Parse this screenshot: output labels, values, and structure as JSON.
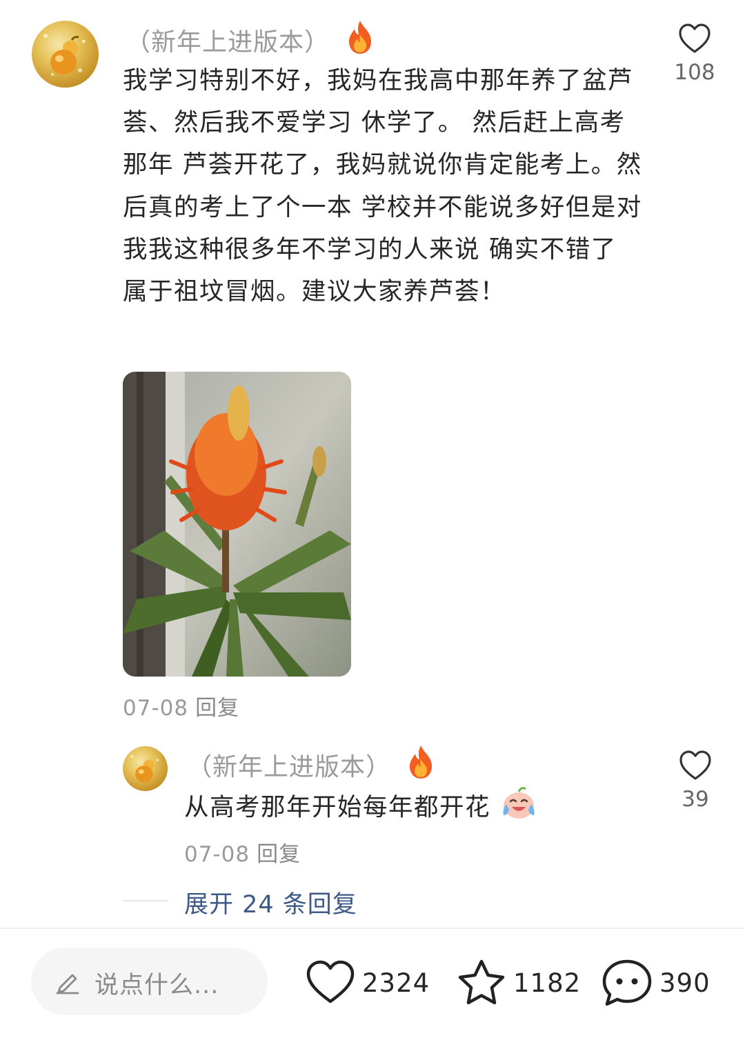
{
  "comment": {
    "username": "（新年上进版本）",
    "text": "我学习特别不好，我妈在我高中那年养了盆芦荟、然后我不爱学习 休学了。 然后赶上高考那年 芦荟开花了，我妈就说你肯定能考上。然后真的考上了个一本 学校并不能说多好但是对我我这种很多年不学习的人来说 确实不错了 属于祖坟冒烟。建议大家养芦荟！",
    "likes": "108",
    "date": "07-08",
    "reply_label": "回复"
  },
  "reply": {
    "username": "（新年上进版本）",
    "text": "从高考那年开始每年都开花",
    "likes": "39",
    "date": "07-08",
    "reply_label": "回复"
  },
  "expand_label": "展开 24 条回复",
  "bottom_bar": {
    "input_placeholder": "说点什么...",
    "likes": "2324",
    "favorites": "1182",
    "comments": "390"
  },
  "icons": {
    "badge": "fire-icon",
    "like": "heart-icon",
    "favorite": "star-icon",
    "comment": "chat-bubble-icon",
    "input": "pencil-icon",
    "emoji": "crying-laughing-emoji"
  },
  "colors": {
    "expand_link": "#3d5a86",
    "muted_text": "#9a9a9a"
  }
}
